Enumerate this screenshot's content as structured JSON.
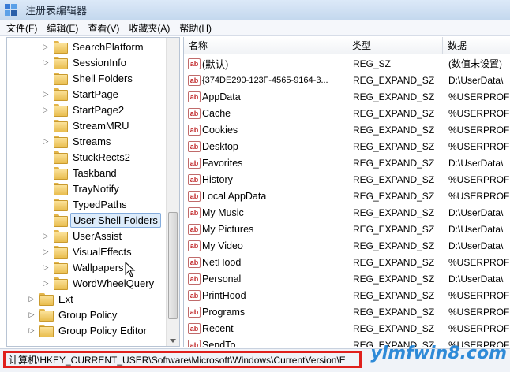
{
  "window": {
    "title": "注册表编辑器"
  },
  "menu": [
    "文件(F)",
    "编辑(E)",
    "查看(V)",
    "收藏夹(A)",
    "帮助(H)"
  ],
  "tree": [
    {
      "label": "SearchPlatform",
      "expander": "▷",
      "level": 1
    },
    {
      "label": "SessionInfo",
      "expander": "▷",
      "level": 1
    },
    {
      "label": "Shell Folders",
      "expander": "",
      "level": 1
    },
    {
      "label": "StartPage",
      "expander": "▷",
      "level": 1
    },
    {
      "label": "StartPage2",
      "expander": "▷",
      "level": 1
    },
    {
      "label": "StreamMRU",
      "expander": "",
      "level": 1
    },
    {
      "label": "Streams",
      "expander": "▷",
      "level": 1
    },
    {
      "label": "StuckRects2",
      "expander": "",
      "level": 1
    },
    {
      "label": "Taskband",
      "expander": "",
      "level": 1
    },
    {
      "label": "TrayNotify",
      "expander": "",
      "level": 1
    },
    {
      "label": "TypedPaths",
      "expander": "",
      "level": 1
    },
    {
      "label": "User Shell Folders",
      "expander": "",
      "level": 1,
      "selected": true
    },
    {
      "label": "UserAssist",
      "expander": "▷",
      "level": 1
    },
    {
      "label": "VisualEffects",
      "expander": "▷",
      "level": 1
    },
    {
      "label": "Wallpapers",
      "expander": "▷",
      "level": 1
    },
    {
      "label": "WordWheelQuery",
      "expander": "▷",
      "level": 1
    },
    {
      "label": "Ext",
      "expander": "▷",
      "level": 0
    },
    {
      "label": "Group Policy",
      "expander": "▷",
      "level": 0
    },
    {
      "label": "Group Policy Editor",
      "expander": "▷",
      "level": 0
    }
  ],
  "columns": [
    "名称",
    "类型",
    "数据"
  ],
  "rows": [
    {
      "name": "(默认)",
      "type": "REG_SZ",
      "data": "(数值未设置)"
    },
    {
      "name": "{374DE290-123F-4565-9164-3...",
      "type": "REG_EXPAND_SZ",
      "data": "D:\\UserData\\"
    },
    {
      "name": "AppData",
      "type": "REG_EXPAND_SZ",
      "data": "%USERPROFI"
    },
    {
      "name": "Cache",
      "type": "REG_EXPAND_SZ",
      "data": "%USERPROFI"
    },
    {
      "name": "Cookies",
      "type": "REG_EXPAND_SZ",
      "data": "%USERPROFI"
    },
    {
      "name": "Desktop",
      "type": "REG_EXPAND_SZ",
      "data": "%USERPROFI"
    },
    {
      "name": "Favorites",
      "type": "REG_EXPAND_SZ",
      "data": "D:\\UserData\\"
    },
    {
      "name": "History",
      "type": "REG_EXPAND_SZ",
      "data": "%USERPROFI"
    },
    {
      "name": "Local AppData",
      "type": "REG_EXPAND_SZ",
      "data": "%USERPROFI"
    },
    {
      "name": "My Music",
      "type": "REG_EXPAND_SZ",
      "data": "D:\\UserData\\"
    },
    {
      "name": "My Pictures",
      "type": "REG_EXPAND_SZ",
      "data": "D:\\UserData\\"
    },
    {
      "name": "My Video",
      "type": "REG_EXPAND_SZ",
      "data": "D:\\UserData\\"
    },
    {
      "name": "NetHood",
      "type": "REG_EXPAND_SZ",
      "data": "%USERPROFI"
    },
    {
      "name": "Personal",
      "type": "REG_EXPAND_SZ",
      "data": "D:\\UserData\\"
    },
    {
      "name": "PrintHood",
      "type": "REG_EXPAND_SZ",
      "data": "%USERPROFI"
    },
    {
      "name": "Programs",
      "type": "REG_EXPAND_SZ",
      "data": "%USERPROFI"
    },
    {
      "name": "Recent",
      "type": "REG_EXPAND_SZ",
      "data": "%USERPROFI"
    },
    {
      "name": "SendTo",
      "type": "REG_EXPAND_SZ",
      "data": "%USERPROFI"
    }
  ],
  "status": {
    "path": "计算机\\HKEY_CURRENT_USER\\Software\\Microsoft\\Windows\\CurrentVersion\\E"
  },
  "watermark": "ylmfwin8.com",
  "colors": {
    "highlight_border": "#e0201c",
    "selection": "#ddecfb"
  }
}
